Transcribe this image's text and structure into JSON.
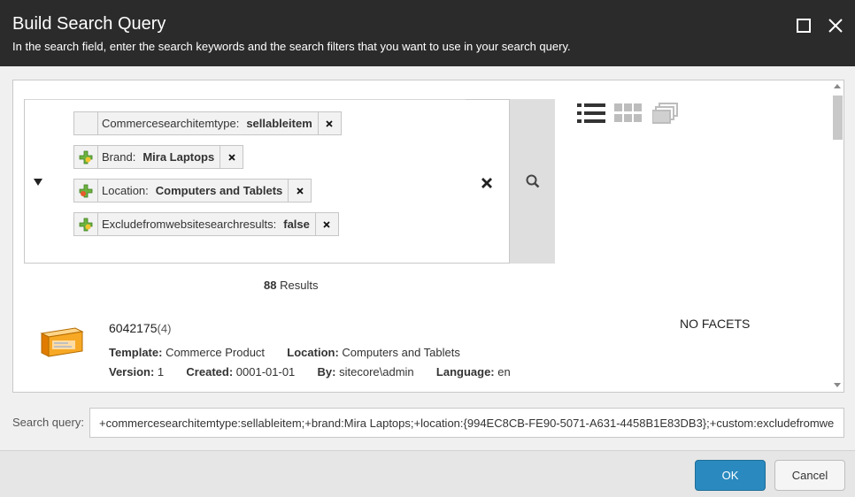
{
  "dialog": {
    "title": "Build Search Query",
    "subtitle": "In the search field, enter the search keywords and the search filters that you want to use in your search query."
  },
  "filters": [
    {
      "icon": "none",
      "name": "Commercesearchitemtype:",
      "value": "sellableitem"
    },
    {
      "icon": "plus-icon",
      "name": "Brand:",
      "value": "Mira Laptops"
    },
    {
      "icon": "plus-icon",
      "name": "Location:",
      "value": "Computers and Tablets"
    },
    {
      "icon": "plus-icon",
      "name": "Excludefromwebsitesearchresults:",
      "value": "false"
    }
  ],
  "results": {
    "count": "88",
    "label": "Results"
  },
  "item": {
    "name": "6042175",
    "version_suffix": "(4)",
    "template_label": "Template:",
    "template": "Commerce Product",
    "location_label": "Location:",
    "location": "Computers and Tablets",
    "version_label": "Version:",
    "version": "1",
    "created_label": "Created:",
    "created": "0001-01-01",
    "by_label": "By:",
    "by": "sitecore\\admin",
    "language_label": "Language:",
    "language": "en"
  },
  "facets": {
    "empty_label": "NO FACETS"
  },
  "search_query": {
    "label": "Search query:",
    "value": "+commercesearchitemtype:sellableitem;+brand:Mira Laptops;+location:{994EC8CB-FE90-5071-A631-4458B1E83DB3};+custom:excludefromwebsitesearchresults|false"
  },
  "buttons": {
    "ok": "OK",
    "cancel": "Cancel"
  },
  "colors": {
    "titlebar": "#2b2b2b",
    "ok_button": "#2a8ac0",
    "plus_green": "#6db33f",
    "plus_yellow": "#f4c430"
  }
}
